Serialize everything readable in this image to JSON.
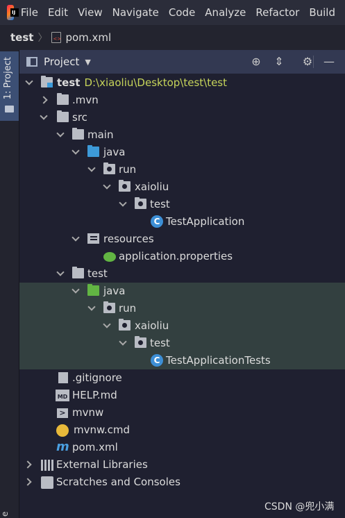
{
  "menu": {
    "logo_text": "IJ",
    "items": [
      "File",
      "Edit",
      "View",
      "Navigate",
      "Code",
      "Analyze",
      "Refactor",
      "Build"
    ]
  },
  "breadcrumb": {
    "root": "test",
    "file": "pom.xml"
  },
  "side_stripe": {
    "project_tab": "1: Project",
    "bottom_tab": "e"
  },
  "panel": {
    "title": "Project"
  },
  "tree": [
    {
      "label": "test",
      "suffix": "D:\\xiaoliu\\Desktop\\test\\test",
      "icon": "module-folder",
      "arrow": "down",
      "bold": true
    },
    {
      "label": ".mvn",
      "icon": "folder",
      "arrow": "right"
    },
    {
      "label": "src",
      "icon": "folder",
      "arrow": "down"
    },
    {
      "label": "main",
      "icon": "folder",
      "arrow": "down"
    },
    {
      "label": "java",
      "icon": "source-folder",
      "arrow": "down"
    },
    {
      "label": "run",
      "icon": "package",
      "arrow": "down"
    },
    {
      "label": "xaioliu",
      "icon": "package",
      "arrow": "down"
    },
    {
      "label": "test",
      "icon": "package",
      "arrow": "down"
    },
    {
      "label": "TestApplication",
      "icon": "spring-boot-class"
    },
    {
      "label": "resources",
      "icon": "resources-folder",
      "arrow": "down"
    },
    {
      "label": "application.properties",
      "icon": "spring-properties"
    },
    {
      "label": "test",
      "icon": "folder",
      "arrow": "down"
    },
    {
      "label": "java",
      "icon": "test-source-folder",
      "arrow": "down"
    },
    {
      "label": "run",
      "icon": "package",
      "arrow": "down"
    },
    {
      "label": "xaioliu",
      "icon": "package",
      "arrow": "down"
    },
    {
      "label": "test",
      "icon": "package",
      "arrow": "down"
    },
    {
      "label": "TestApplicationTests",
      "icon": "test-class"
    },
    {
      "label": ".gitignore",
      "icon": "text-file"
    },
    {
      "label": "HELP.md",
      "icon": "markdown-file"
    },
    {
      "label": "mvnw",
      "icon": "shell-file"
    },
    {
      "label": "mvnw.cmd",
      "icon": "cmd-file"
    },
    {
      "label": "pom.xml",
      "icon": "maven-file"
    },
    {
      "label": "External Libraries",
      "icon": "library",
      "arrow": "right"
    },
    {
      "label": "Scratches and Consoles",
      "icon": "scratches",
      "arrow": "right"
    }
  ],
  "watermark": "CSDN @兜小满",
  "colors": {
    "background": "#1f2030",
    "header": "#333952",
    "test_highlight": "#334040",
    "path": "#c6d45a",
    "source_folder": "#3d9ad8",
    "test_folder": "#62b543"
  }
}
